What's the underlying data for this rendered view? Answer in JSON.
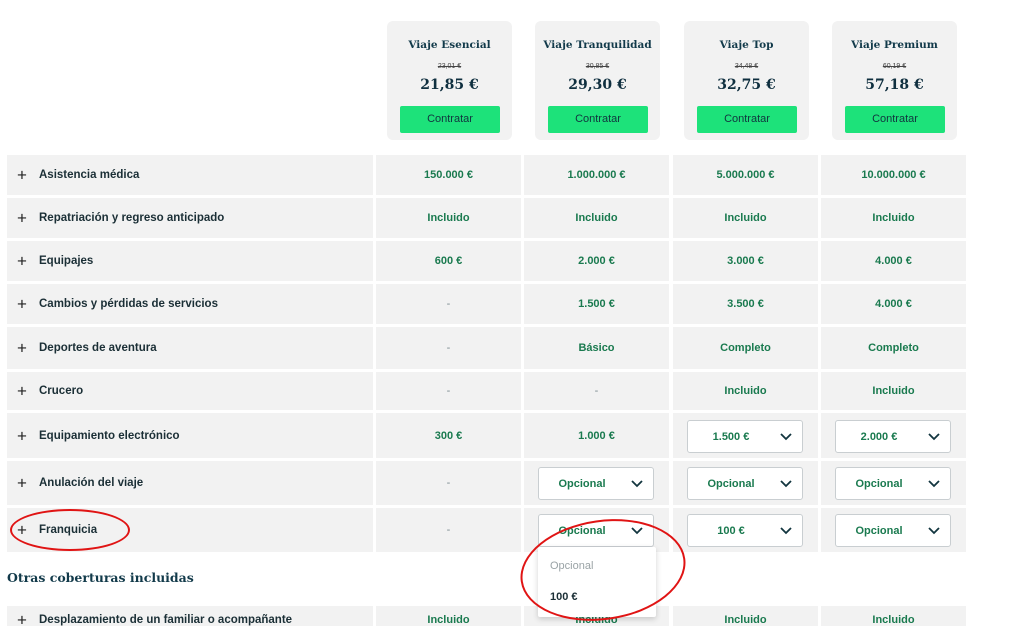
{
  "plans": [
    {
      "name": "Viaje Esencial",
      "old_price": "23,01 €",
      "price": "21,85 €",
      "button": "Contratar"
    },
    {
      "name": "Viaje Tranquilidad",
      "old_price": "30,85 €",
      "price": "29,30 €",
      "button": "Contratar"
    },
    {
      "name": "Viaje Top",
      "old_price": "34,48 €",
      "price": "32,75 €",
      "button": "Contratar"
    },
    {
      "name": "Viaje Premium",
      "old_price": "60,19 €",
      "price": "57,18 €",
      "button": "Contratar"
    }
  ],
  "rows": [
    {
      "label": "Asistencia médica",
      "values": [
        "150.000 €",
        "1.000.000 €",
        "5.000.000 €",
        "10.000.000 €"
      ]
    },
    {
      "label": "Repatriación y regreso anticipado",
      "values": [
        "Incluido",
        "Incluido",
        "Incluido",
        "Incluido"
      ]
    },
    {
      "label": "Equipajes",
      "values": [
        "600 €",
        "2.000 €",
        "3.000 €",
        "4.000 €"
      ]
    },
    {
      "label": "Cambios y pérdidas de servicios",
      "values": [
        "-",
        "1.500 €",
        "3.500 €",
        "4.000 €"
      ]
    },
    {
      "label": "Deportes de aventura",
      "values": [
        "-",
        "Básico",
        "Completo",
        "Completo"
      ]
    },
    {
      "label": "Crucero",
      "values": [
        "-",
        "-",
        "Incluido",
        "Incluido"
      ]
    },
    {
      "label": "Equipamiento electrónico",
      "values": [
        "300 €",
        "1.000 €",
        "1.500 €",
        "2.000 €"
      ]
    },
    {
      "label": "Anulación del viaje",
      "values": [
        "-",
        "Opcional",
        "Opcional",
        "Opcional"
      ]
    },
    {
      "label": "Franquicia",
      "values": [
        "-",
        "Opcional",
        "100 €",
        "Opcional"
      ]
    }
  ],
  "section_title": "Otras coberturas incluidas",
  "partial_row": {
    "label": "Desplazamiento de un familiar o acompañante",
    "values": [
      "Incluido",
      "Incluido",
      "Incluido",
      "Incluido"
    ]
  },
  "dropdown_options": [
    "Opcional",
    "100 €"
  ],
  "colors": {
    "accent_button": "#1de27a",
    "value_text": "#1a7a4f",
    "row_bg": "#f2f2f2",
    "annotation": "#e01414"
  }
}
